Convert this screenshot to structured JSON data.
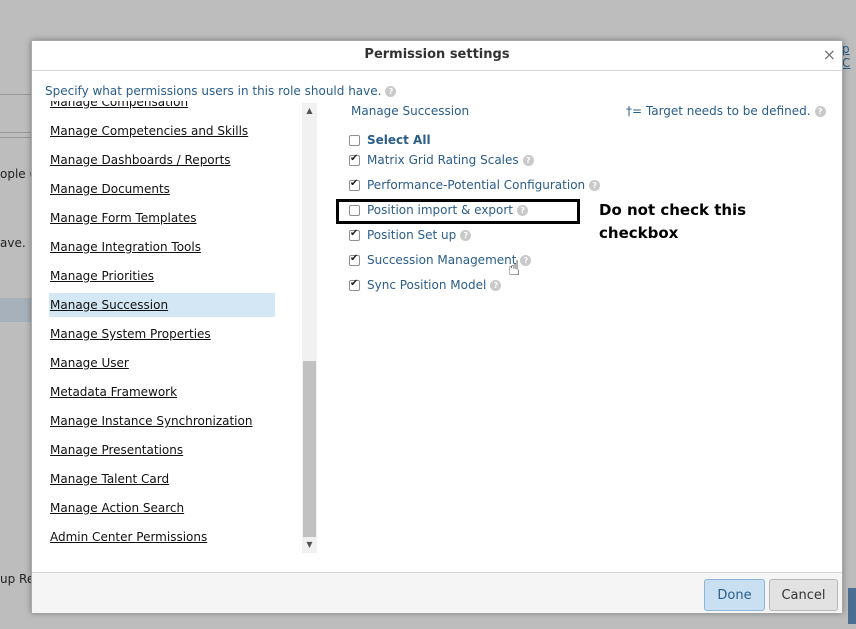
{
  "background": {
    "left_texts": [
      "ople (",
      "ave.",
      "up Re"
    ],
    "right_link": "p C"
  },
  "dialog": {
    "title": "Permission settings",
    "close_glyph": "×",
    "instruction": "Specify what permissions users in this role should have."
  },
  "left_nav": {
    "items": [
      {
        "label": "Manage Compensation"
      },
      {
        "label": "Manage Competencies and Skills"
      },
      {
        "label": "Manage Dashboards / Reports"
      },
      {
        "label": "Manage Documents"
      },
      {
        "label": "Manage Form Templates"
      },
      {
        "label": "Manage Integration Tools"
      },
      {
        "label": "Manage Priorities"
      },
      {
        "label": "Manage Succession",
        "selected": true
      },
      {
        "label": "Manage System Properties"
      },
      {
        "label": "Manage User"
      },
      {
        "label": "Metadata Framework"
      },
      {
        "label": "Manage Instance Synchronization"
      },
      {
        "label": "Manage Presentations"
      },
      {
        "label": "Manage Talent Card"
      },
      {
        "label": "Manage Action Search"
      },
      {
        "label": "Admin Center Permissions"
      }
    ],
    "scroll_up_glyph": "▲",
    "scroll_down_glyph": "▼"
  },
  "panel": {
    "section_title": "Manage Succession",
    "target_note": "†= Target needs to be defined.",
    "permissions": [
      {
        "label": "Select All",
        "checked": false,
        "help": false
      },
      {
        "label": "Matrix Grid Rating Scales",
        "checked": true,
        "help": true
      },
      {
        "label": "Performance-Potential Configuration",
        "checked": true,
        "help": true
      },
      {
        "label": "Position import & export",
        "checked": false,
        "help": true
      },
      {
        "label": "Position Set up",
        "checked": true,
        "help": true
      },
      {
        "label": "Succession Management",
        "checked": true,
        "help": true
      },
      {
        "label": "Sync Position Model",
        "checked": true,
        "help": true
      }
    ]
  },
  "annotation": {
    "text_line1": "Do not check this",
    "text_line2": "checkbox"
  },
  "footer": {
    "done_label": "Done",
    "cancel_label": "Cancel"
  },
  "icons": {
    "help_icon": "help-icon",
    "cursor_icon": "hand-pointer-icon"
  },
  "colors": {
    "link_blue": "#2a5d8a",
    "selected_row": "#d3e7f4",
    "done_button": "#c9e0f3"
  }
}
